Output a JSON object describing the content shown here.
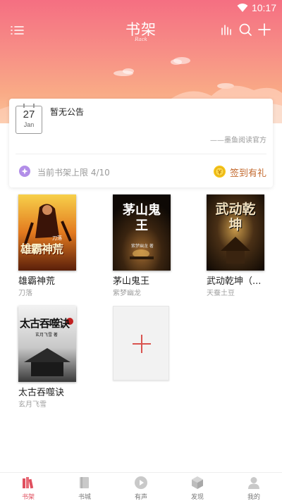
{
  "status_bar": {
    "time": "10:17"
  },
  "header": {
    "title": "书架",
    "subtitle": "Rack"
  },
  "notice": {
    "date_day": "27",
    "date_month": "Jan",
    "title": "暂无公告",
    "signature": "——墨鱼阅读官方",
    "shelf_limit": "当前书架上限 4/10",
    "checkin_label": "签到有礼"
  },
  "books": [
    {
      "name": "雄霸神荒",
      "author": "刀落",
      "cover_text": "雄霸神荒",
      "cover_author": "刀落"
    },
    {
      "name": "茅山鬼王",
      "author": "紫梦幽龙",
      "cover_text": "茅山鬼王",
      "cover_author": "紫梦幽龙 著"
    },
    {
      "name": "武动乾坤（...",
      "author": "天蚕土豆",
      "cover_text": "武动乾坤"
    },
    {
      "name": "太古吞噬诀",
      "author": "玄月飞雪",
      "cover_text": "太古吞噬诀",
      "cover_author": "玄月飞雪 著"
    }
  ],
  "bottom_nav": [
    {
      "label": "书架",
      "icon": "bookshelf-icon",
      "active": true
    },
    {
      "label": "书城",
      "icon": "bookstore-icon",
      "active": false
    },
    {
      "label": "有声",
      "icon": "audio-play-icon",
      "active": false
    },
    {
      "label": "发现",
      "icon": "discover-cube-icon",
      "active": false
    },
    {
      "label": "我的",
      "icon": "user-profile-icon",
      "active": false
    }
  ],
  "colors": {
    "accent": "#e0505f",
    "header_top": "#f56f82",
    "header_bottom": "#fbc39a",
    "checkin": "#c36a2f"
  }
}
